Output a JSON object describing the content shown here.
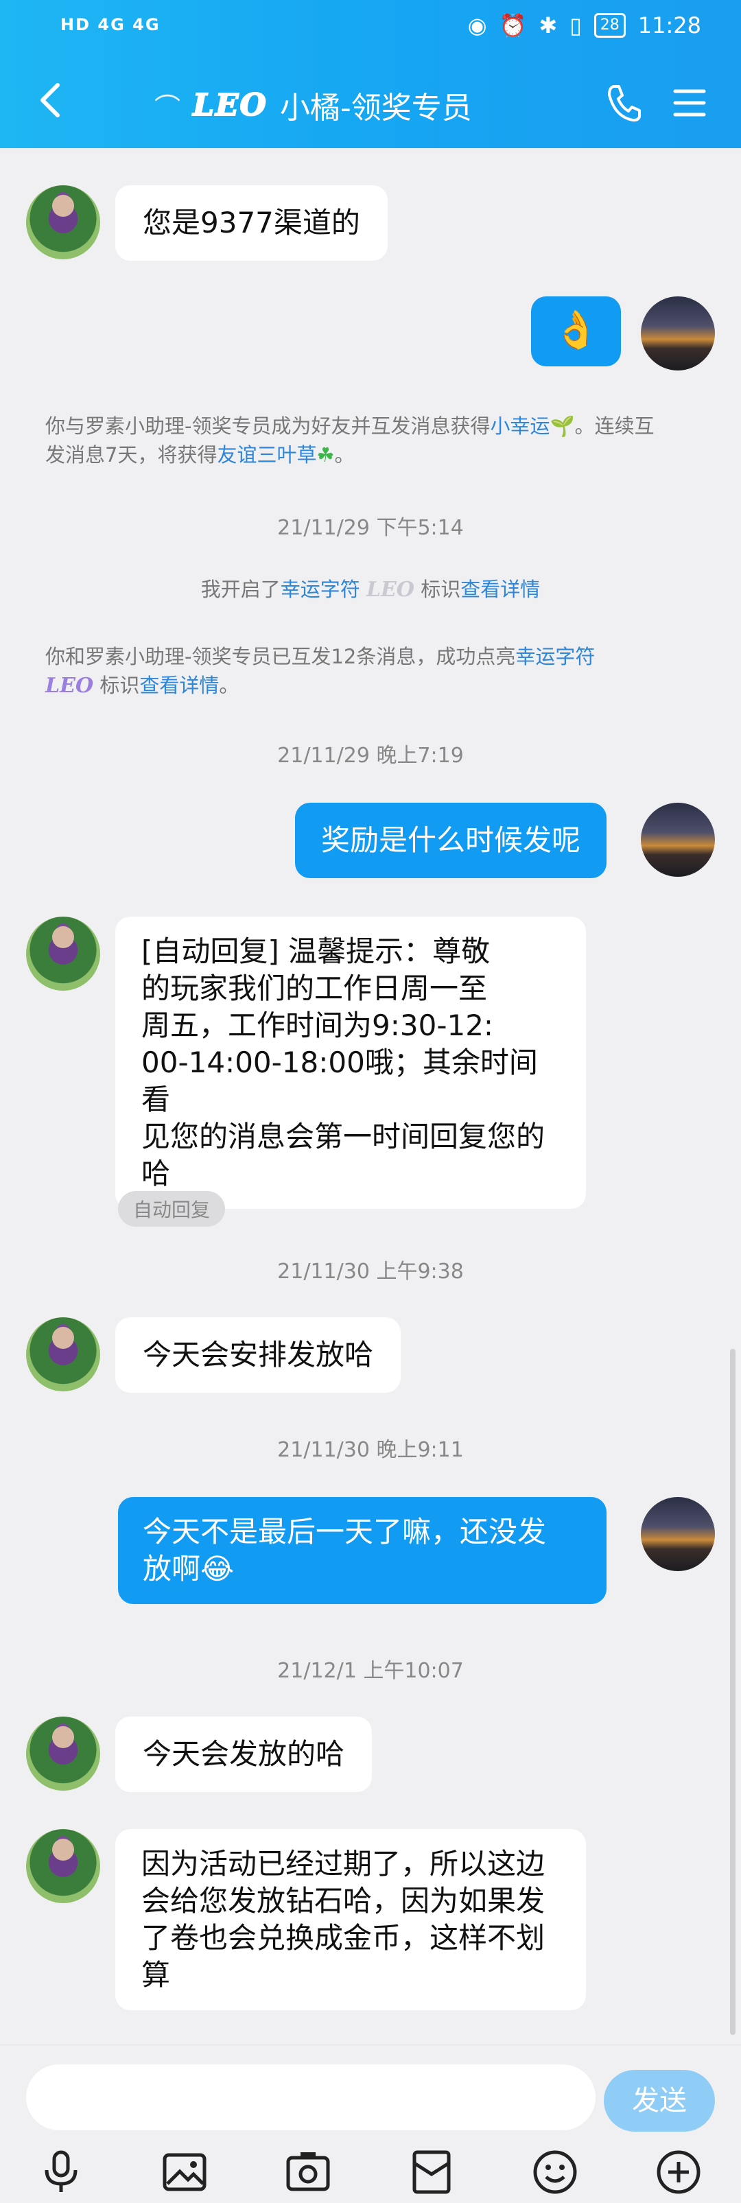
{
  "status_bar": {
    "left_text": "HD 4G 4G",
    "battery": "28",
    "time": "11:28"
  },
  "header": {
    "badge": "LEO",
    "title": "小橘-领奖专员"
  },
  "messages": [
    {
      "side": "left",
      "text": "您是9377渠道的"
    },
    {
      "side": "right",
      "emoji": "👌"
    },
    {
      "type": "system",
      "prefix": "你与罗素小助理-领奖专员成为好友并互发消息获得",
      "link1": "小幸运",
      "mid": "。连续互发消息7天，将获得",
      "link2": "友谊三叶草",
      "suffix": "。"
    },
    {
      "type": "timestamp",
      "text": "21/11/29 下午5:14"
    },
    {
      "type": "system",
      "prefix": "我开启了",
      "link1": "幸运字符",
      "badge": "LEO",
      "mid": "标识",
      "link2": "查看详情"
    },
    {
      "type": "system",
      "prefix": "你和罗素小助理-领奖专员已互发12条消息，成功点亮",
      "link1": "幸运字符",
      "badge": "LEO",
      "mid": "标识",
      "link2": "查看详情",
      "suffix": "。"
    },
    {
      "type": "timestamp",
      "text": "21/11/29 晚上7:19"
    },
    {
      "side": "right",
      "text": "奖励是什么时候发呢"
    },
    {
      "side": "left",
      "text_lines": [
        "[自动回复] 温馨提示：尊敬",
        "的玩家我们的工作日周一至",
        "周五，工作时间为9:30-12:",
        "00-14:00-18:00哦；其余时间看",
        "见您的消息会第一时间回复您的",
        "哈"
      ]
    },
    {
      "type": "tag",
      "text": "自动回复"
    },
    {
      "type": "timestamp",
      "text": "21/11/30 上午9:38"
    },
    {
      "side": "left",
      "text": "今天会安排发放哈"
    },
    {
      "type": "timestamp",
      "text": "21/11/30 晚上9:11"
    },
    {
      "side": "right",
      "text_lines": [
        "今天不是最后一天了嘛，还没发",
        "放啊😂"
      ]
    },
    {
      "type": "timestamp",
      "text": "21/12/1 上午10:07"
    },
    {
      "side": "left",
      "text": "今天会发放的哈"
    },
    {
      "side": "left",
      "text_lines": [
        "因为活动已经过期了，所以这边",
        "会给您发放钻石哈，因为如果发",
        "了卷也会兑换成金币，这样不划",
        "算"
      ]
    }
  ],
  "input": {
    "send_label": "发送"
  },
  "toolbar_icons": [
    "microphone-icon",
    "image-icon",
    "camera-icon",
    "red-packet-icon",
    "emoji-icon",
    "plus-icon"
  ]
}
